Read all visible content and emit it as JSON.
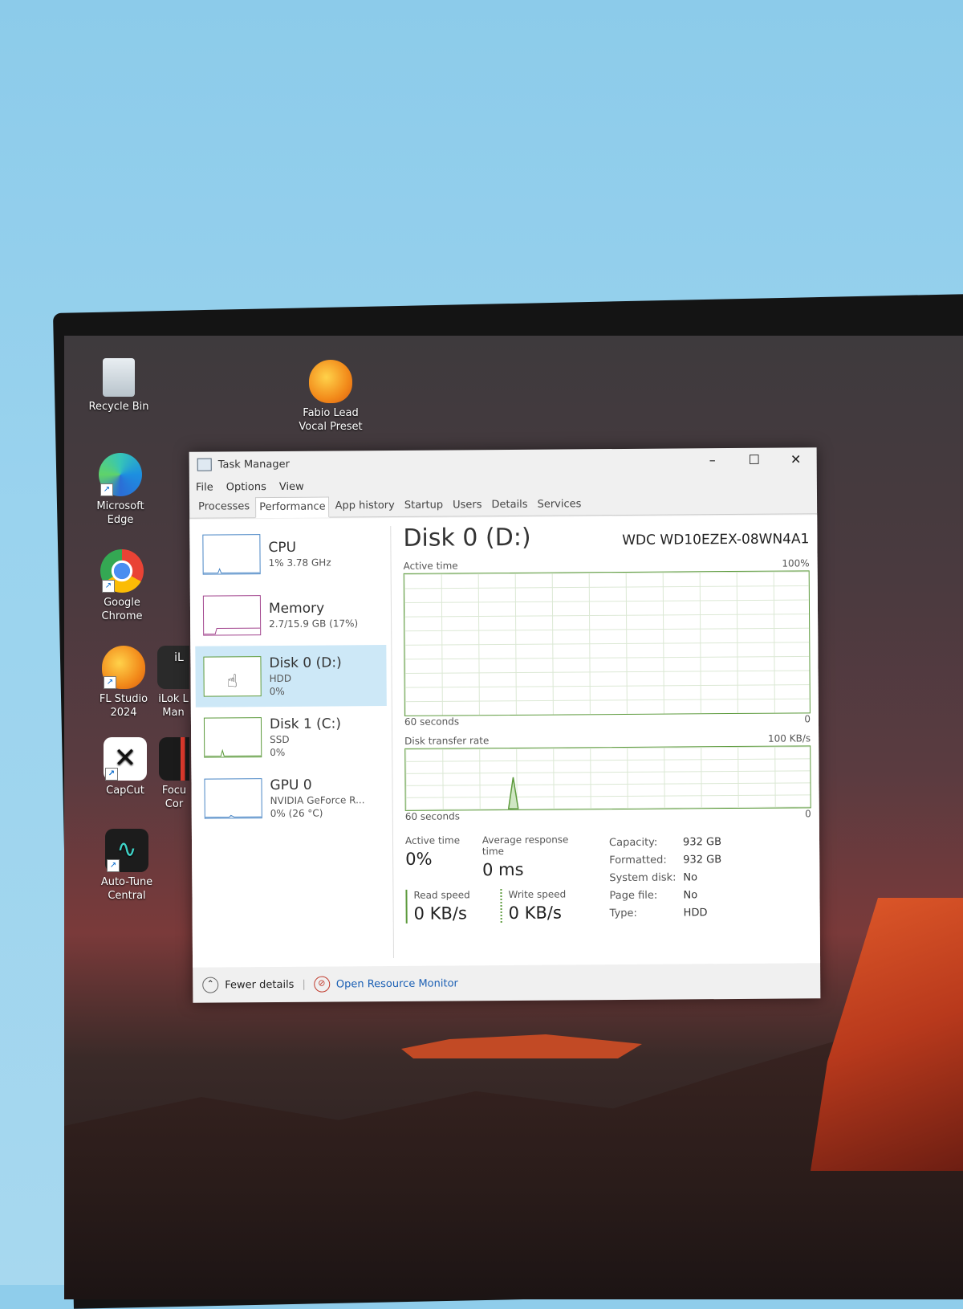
{
  "desktop": {
    "icons": [
      {
        "label": "Recycle Bin",
        "icon": "recycle-bin-icon"
      },
      {
        "label": "Fabio Lead Vocal Preset",
        "icon": "fl-studio-icon"
      },
      {
        "label": "Microsoft Edge",
        "icon": "edge-icon"
      },
      {
        "label": "Google Chrome",
        "icon": "chrome-icon"
      },
      {
        "label": "FL Studio 2024",
        "icon": "fl-studio-icon"
      },
      {
        "label": "iLok L Man",
        "icon": "ilok-icon"
      },
      {
        "label": "CapCut",
        "icon": "capcut-icon"
      },
      {
        "label": "Focu Cor",
        "icon": "focusrite-icon"
      },
      {
        "label": "Auto-Tune Central",
        "icon": "autotune-icon"
      }
    ]
  },
  "task_manager": {
    "title": "Task Manager",
    "menu": [
      "File",
      "Options",
      "View"
    ],
    "tabs": [
      "Processes",
      "Performance",
      "App history",
      "Startup",
      "Users",
      "Details",
      "Services"
    ],
    "active_tab": "Performance",
    "sidebar": [
      {
        "name": "CPU",
        "line1": "1% 3.78 GHz",
        "line2": ""
      },
      {
        "name": "Memory",
        "line1": "2.7/15.9 GB (17%)",
        "line2": ""
      },
      {
        "name": "Disk 0 (D:)",
        "line1": "HDD",
        "line2": "0%"
      },
      {
        "name": "Disk 1 (C:)",
        "line1": "SSD",
        "line2": "0%"
      },
      {
        "name": "GPU 0",
        "line1": "NVIDIA GeForce R...",
        "line2": "0% (26 °C)"
      }
    ],
    "selected_item": "Disk 0 (D:)",
    "detail": {
      "title": "Disk 0 (D:)",
      "model": "WDC WD10EZEX-08WN4A1",
      "graph1": {
        "label": "Active time",
        "max": "100%",
        "span": "60 seconds",
        "min": "0"
      },
      "graph2": {
        "label": "Disk transfer rate",
        "max": "100 KB/s",
        "span": "60 seconds",
        "min": "0"
      },
      "active_time_label": "Active time",
      "active_time_value": "0%",
      "avg_response_label": "Average response time",
      "avg_response_value": "0 ms",
      "read_label": "Read speed",
      "read_value": "0 KB/s",
      "write_label": "Write speed",
      "write_value": "0 KB/s",
      "properties": [
        {
          "k": "Capacity:",
          "v": "932 GB"
        },
        {
          "k": "Formatted:",
          "v": "932 GB"
        },
        {
          "k": "System disk:",
          "v": "No"
        },
        {
          "k": "Page file:",
          "v": "No"
        },
        {
          "k": "Type:",
          "v": "HDD"
        }
      ]
    },
    "footer": {
      "fewer": "Fewer details",
      "monitor": "Open Resource Monitor"
    },
    "colors": {
      "disk_green": "#5c9a3c",
      "selection": "#cde8f7",
      "link": "#1a5fb4"
    }
  }
}
